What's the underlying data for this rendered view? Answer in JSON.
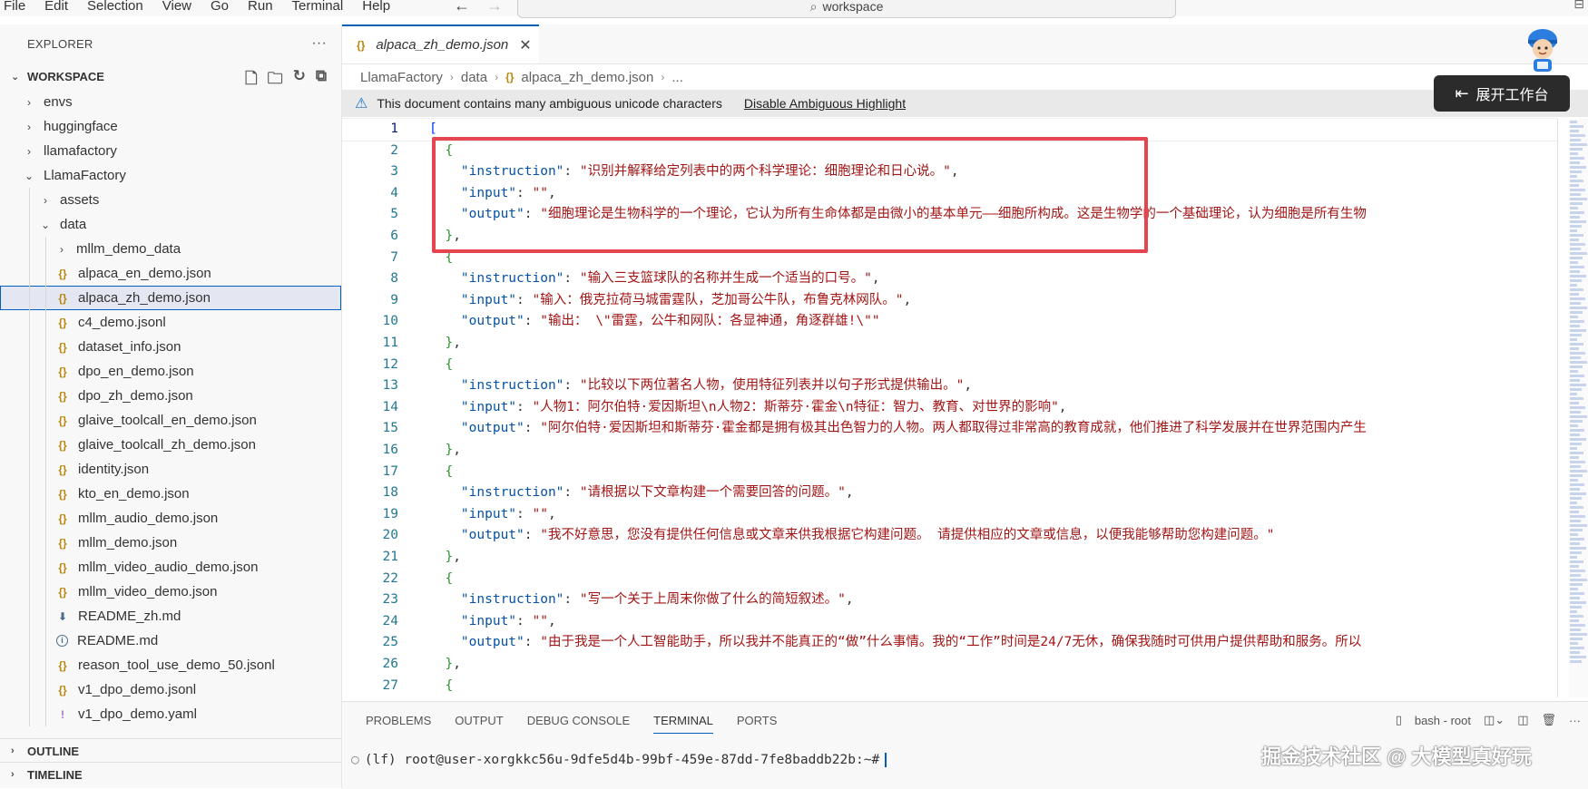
{
  "menu": [
    "File",
    "Edit",
    "Selection",
    "View",
    "Go",
    "Run",
    "Terminal",
    "Help"
  ],
  "search": {
    "text": "workspace"
  },
  "explorer": {
    "title": "EXPLORER",
    "workspace_label": "WORKSPACE",
    "items": [
      {
        "label": "envs",
        "indent": 0,
        "type": "folder",
        "open": false
      },
      {
        "label": "huggingface",
        "indent": 0,
        "type": "folder",
        "open": false
      },
      {
        "label": "llamafactory",
        "indent": 0,
        "type": "folder",
        "open": false
      },
      {
        "label": "LlamaFactory",
        "indent": 0,
        "type": "folder",
        "open": true
      },
      {
        "label": "assets",
        "indent": 1,
        "type": "folder",
        "open": false
      },
      {
        "label": "data",
        "indent": 1,
        "type": "folder",
        "open": true
      },
      {
        "label": "mllm_demo_data",
        "indent": 2,
        "type": "folder",
        "open": false
      },
      {
        "label": "alpaca_en_demo.json",
        "indent": 2,
        "type": "json"
      },
      {
        "label": "alpaca_zh_demo.json",
        "indent": 2,
        "type": "json",
        "selected": true
      },
      {
        "label": "c4_demo.jsonl",
        "indent": 2,
        "type": "json"
      },
      {
        "label": "dataset_info.json",
        "indent": 2,
        "type": "json"
      },
      {
        "label": "dpo_en_demo.json",
        "indent": 2,
        "type": "json"
      },
      {
        "label": "dpo_zh_demo.json",
        "indent": 2,
        "type": "json"
      },
      {
        "label": "glaive_toolcall_en_demo.json",
        "indent": 2,
        "type": "json"
      },
      {
        "label": "glaive_toolcall_zh_demo.json",
        "indent": 2,
        "type": "json"
      },
      {
        "label": "identity.json",
        "indent": 2,
        "type": "json"
      },
      {
        "label": "kto_en_demo.json",
        "indent": 2,
        "type": "json"
      },
      {
        "label": "mllm_audio_demo.json",
        "indent": 2,
        "type": "json"
      },
      {
        "label": "mllm_demo.json",
        "indent": 2,
        "type": "json"
      },
      {
        "label": "mllm_video_audio_demo.json",
        "indent": 2,
        "type": "json"
      },
      {
        "label": "mllm_video_demo.json",
        "indent": 2,
        "type": "json"
      },
      {
        "label": "README_zh.md",
        "indent": 2,
        "type": "md-dl"
      },
      {
        "label": "README.md",
        "indent": 2,
        "type": "info"
      },
      {
        "label": "reason_tool_use_demo_50.jsonl",
        "indent": 2,
        "type": "json"
      },
      {
        "label": "v1_dpo_demo.jsonl",
        "indent": 2,
        "type": "json"
      },
      {
        "label": "v1_dpo_demo.yaml",
        "indent": 2,
        "type": "yaml"
      }
    ],
    "outline_label": "OUTLINE",
    "timeline_label": "TIMELINE"
  },
  "editor": {
    "tab_label": "alpaca_zh_demo.json",
    "breadcrumb": [
      "LlamaFactory",
      "data",
      "alpaca_zh_demo.json",
      "..."
    ],
    "banner_text": "This document contains many ambiguous unicode characters",
    "banner_link": "Disable Ambiguous Highlight",
    "lines": [
      {
        "n": "1",
        "html": "<span class='br1'>[</span>"
      },
      {
        "n": "2",
        "html": "  <span class='br2'>{</span>"
      },
      {
        "n": "3",
        "html": "    <span class='k'>\"instruction\"</span><span class='p'>: </span><span class='s'>\"识别并解释给定列表中的两个科学理论：细胞理论和日心说。\"</span><span class='p'>,</span>"
      },
      {
        "n": "4",
        "html": "    <span class='k'>\"input\"</span><span class='p'>: </span><span class='s'>\"\"</span><span class='p'>,</span>"
      },
      {
        "n": "5",
        "html": "    <span class='k'>\"output\"</span><span class='p'>: </span><span class='s'>\"细胞理论是生物科学的一个理论，它认为所有生命体都是由微小的基本单元——细胞所构成。这是生物学的一个基础理论，认为细胞是所有生物</span>"
      },
      {
        "n": "6",
        "html": "  <span class='br2'>}</span><span class='p'>,</span>"
      },
      {
        "n": "7",
        "html": "  <span class='br2'>{</span>"
      },
      {
        "n": "8",
        "html": "    <span class='k'>\"instruction\"</span><span class='p'>: </span><span class='s'>\"输入三支篮球队的名称并生成一个适当的口号。\"</span><span class='p'>,</span>"
      },
      {
        "n": "9",
        "html": "    <span class='k'>\"input\"</span><span class='p'>: </span><span class='s'>\"输入：俄克拉荷马城雷霆队，芝加哥公牛队，布鲁克林网队。\"</span><span class='p'>,</span>"
      },
      {
        "n": "10",
        "html": "    <span class='k'>\"output\"</span><span class='p'>: </span><span class='s'>\"输出： \\\"雷霆，公牛和网队：各显神通，角逐群雄!\\\"\"</span>"
      },
      {
        "n": "11",
        "html": "  <span class='br2'>}</span><span class='p'>,</span>"
      },
      {
        "n": "12",
        "html": "  <span class='br2'>{</span>"
      },
      {
        "n": "13",
        "html": "    <span class='k'>\"instruction\"</span><span class='p'>: </span><span class='s'>\"比较以下两位著名人物，使用特征列表并以句子形式提供输出。\"</span><span class='p'>,</span>"
      },
      {
        "n": "14",
        "html": "    <span class='k'>\"input\"</span><span class='p'>: </span><span class='s'>\"人物1：阿尔伯特·爱因斯坦\\n人物2：斯蒂芬·霍金\\n特征：智力、教育、对世界的影响\"</span><span class='p'>,</span>"
      },
      {
        "n": "15",
        "html": "    <span class='k'>\"output\"</span><span class='p'>: </span><span class='s'>\"阿尔伯特·爱因斯坦和斯蒂芬·霍金都是拥有极其出色智力的人物。两人都取得过非常高的教育成就，他们推进了科学发展并在世界范围内产生</span>"
      },
      {
        "n": "16",
        "html": "  <span class='br2'>}</span><span class='p'>,</span>"
      },
      {
        "n": "17",
        "html": "  <span class='br2'>{</span>"
      },
      {
        "n": "18",
        "html": "    <span class='k'>\"instruction\"</span><span class='p'>: </span><span class='s'>\"请根据以下文章构建一个需要回答的问题。\"</span><span class='p'>,</span>"
      },
      {
        "n": "19",
        "html": "    <span class='k'>\"input\"</span><span class='p'>: </span><span class='s'>\"\"</span><span class='p'>,</span>"
      },
      {
        "n": "20",
        "html": "    <span class='k'>\"output\"</span><span class='p'>: </span><span class='s'>\"我不好意思，您没有提供任何信息或文章来供我根据它构建问题。 请提供相应的文章或信息，以便我能够帮助您构建问题。\"</span>"
      },
      {
        "n": "21",
        "html": "  <span class='br2'>}</span><span class='p'>,</span>"
      },
      {
        "n": "22",
        "html": "  <span class='br2'>{</span>"
      },
      {
        "n": "23",
        "html": "    <span class='k'>\"instruction\"</span><span class='p'>: </span><span class='s'>\"写一个关于上周末你做了什么的简短叙述。\"</span><span class='p'>,</span>"
      },
      {
        "n": "24",
        "html": "    <span class='k'>\"input\"</span><span class='p'>: </span><span class='s'>\"\"</span><span class='p'>,</span>"
      },
      {
        "n": "25",
        "html": "    <span class='k'>\"output\"</span><span class='p'>: </span><span class='s'>\"由于我是一个人工智能助手，所以我并不能真正的“做”什么事情。我的“工作”时间是24/7无休，确保我随时可供用户提供帮助和服务。所以</span>"
      },
      {
        "n": "26",
        "html": "  <span class='br2'>}</span><span class='p'>,</span>"
      },
      {
        "n": "27",
        "html": "  <span class='br2'>{</span>"
      }
    ]
  },
  "panel": {
    "tabs": [
      "PROBLEMS",
      "OUTPUT",
      "DEBUG CONSOLE",
      "TERMINAL",
      "PORTS"
    ],
    "active_tab": "TERMINAL",
    "terminal_name": "bash - root",
    "prompt": "(lf) root@user-xorgkkc56u-9dfe5d4b-99bf-459e-87dd-7fe8baddb22b:~#"
  },
  "float_button": "展开工作台",
  "watermark": "掘金技术社区 @ 大模型真好玩"
}
